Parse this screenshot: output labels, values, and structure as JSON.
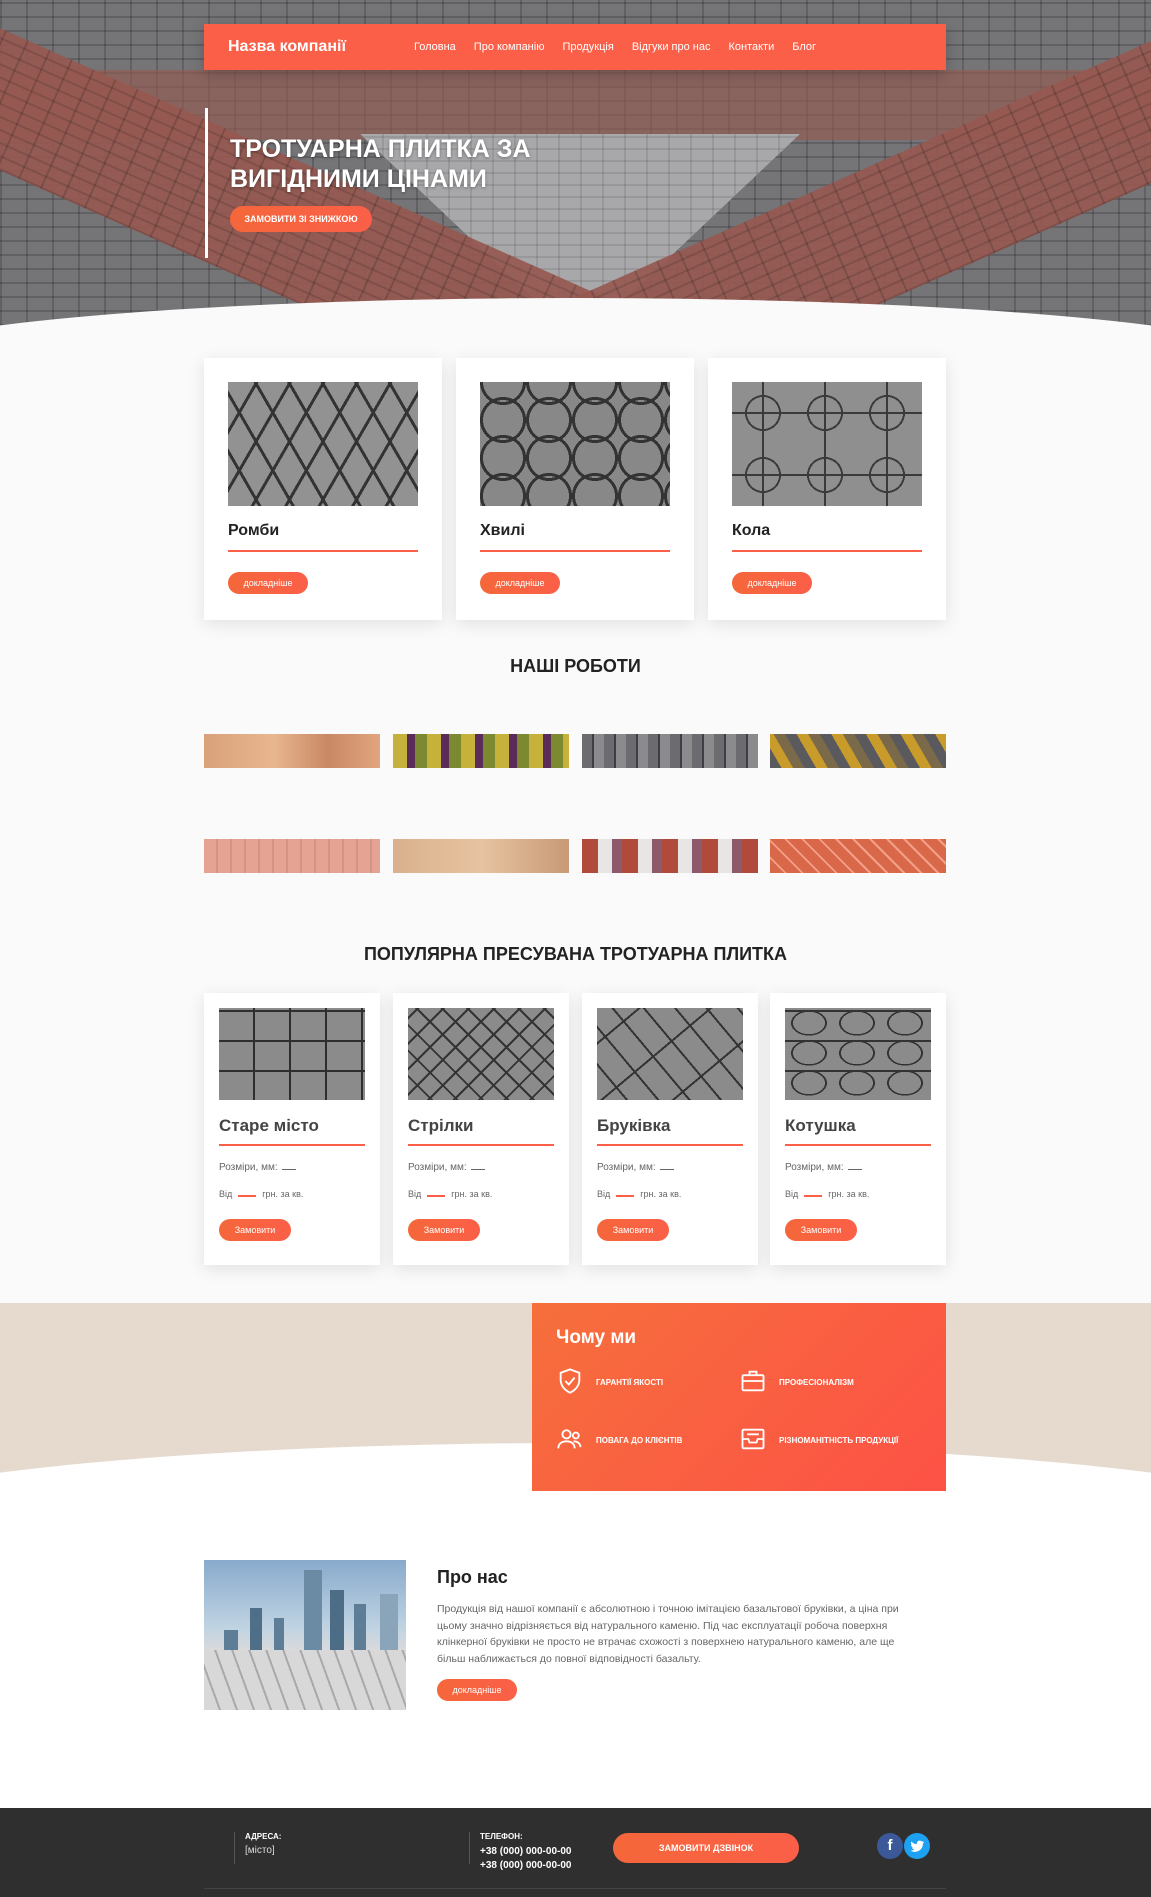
{
  "header": {
    "brand": "Назва компанії",
    "nav": [
      "Головна",
      "Про компанію",
      "Продукція",
      "Відгуки про нас",
      "Контакти",
      "Блог"
    ]
  },
  "hero": {
    "title": "ТРОТУАРНА ПЛИТКА ЗА ВИГІДНИМИ ЦІНАМИ",
    "button": "ЗАМОВИТИ ЗІ ЗНИЖКОЮ"
  },
  "categories": [
    {
      "name": "Ромби",
      "button": "докладніше"
    },
    {
      "name": "Хвилі",
      "button": "докладніше"
    },
    {
      "name": "Кола",
      "button": "докладніше"
    }
  ],
  "works": {
    "title": "НАШІ РОБОТИ"
  },
  "products": {
    "title": "ПОПУЛЯРНА ПРЕСУВАНА ТРОТУАРНА ПЛИТКА",
    "items": [
      {
        "name": "Старе місто",
        "size": "Розміри, мм:",
        "from": "Від",
        "price_unit": "грн. за кв.",
        "button": "Замовити"
      },
      {
        "name": "Стрілки",
        "size": "Розміри, мм:",
        "from": "Від",
        "price_unit": "грн. за кв.",
        "button": "Замовити"
      },
      {
        "name": "Бруківка",
        "size": "Розміри, мм:",
        "from": "Від",
        "price_unit": "грн. за кв.",
        "button": "Замовити"
      },
      {
        "name": "Котушка",
        "size": "Розміри, мм:",
        "from": "Від",
        "price_unit": "грн. за кв.",
        "button": "Замовити"
      }
    ]
  },
  "why": {
    "title": "Чому ми",
    "items": [
      "ГАРАНТІЇ ЯКОСТІ",
      "ПРОФЕСІОНАЛІЗМ",
      "ПОВАГА ДО КЛІЄНТІВ",
      "РІЗНОМАНІТНІСТЬ ПРОДУКЦІЇ"
    ],
    "icons": [
      "shield-check-icon",
      "briefcase-icon",
      "users-icon",
      "archive-box-icon"
    ]
  },
  "about": {
    "title": "Про нас",
    "text": "Продукція від нашої компанії є абсолютною і точною імітацією базальтової бруківки, а ціна при цьому значно відрізняється від натурального каменю. Під час експлуатації робоча поверхня клінкерної бруківки не просто не втрачає схожості з поверхнею натурального каменю, але ще більш наближається до повної відповідності базальту.",
    "button": "докладніше"
  },
  "footer": {
    "address_label": "АДРЕСА:",
    "address_value": "[місто]",
    "phone_label": "ТЕЛЕФОН:",
    "phone1": "+38 (000) 000-00-00",
    "phone2": "+38 (000) 000-00-00",
    "call_button": "ЗАМОВИТИ ДЗВІНОК",
    "social": [
      "facebook-icon",
      "twitter-icon"
    ]
  },
  "colors": {
    "accent": "#fb5f48",
    "accent_gradient_start": "#f5673a",
    "band": "#e6dace",
    "footer": "#2f2f2f"
  }
}
